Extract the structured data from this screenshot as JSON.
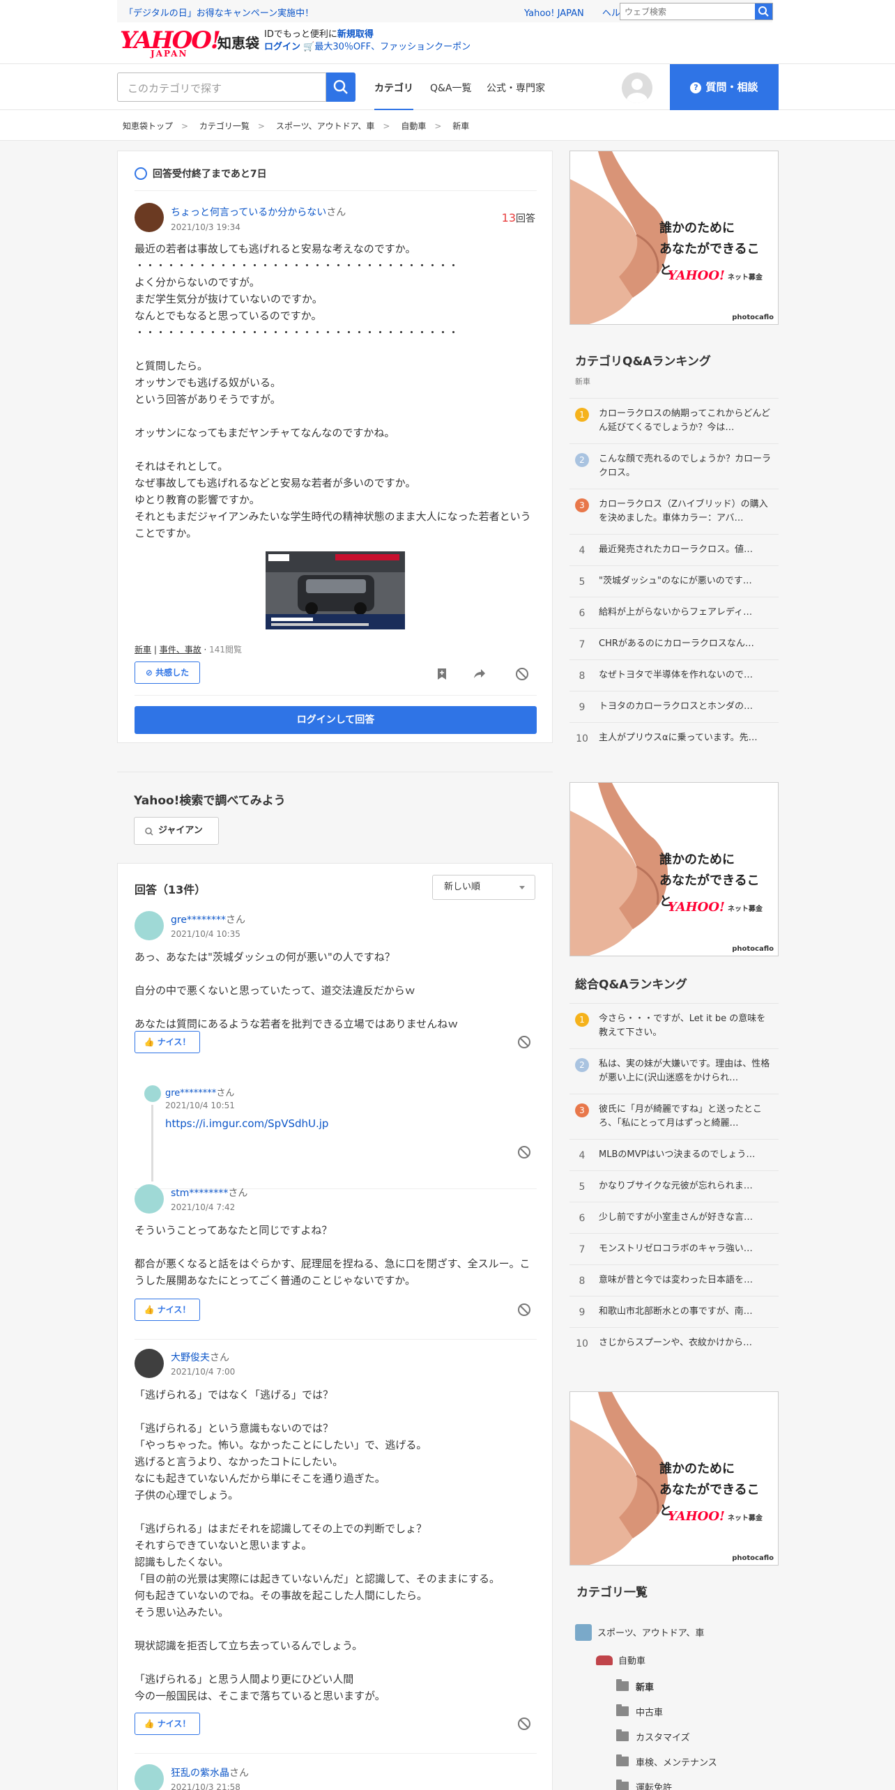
{
  "top": {
    "campaign": "「デジタルの日」お得なキャンペーン実施中！",
    "links": [
      "Yahoo! JAPAN",
      "ヘルプ"
    ],
    "web_search_placeholder": "ウェブ検索"
  },
  "header": {
    "logo_main": "YAHOO!",
    "logo_sub": "JAPAN",
    "service": "知恵袋",
    "id_line1_prefix": "IDでもっと便利に",
    "id_register": "新規取得",
    "id_login": "ログイン",
    "coupon": "最大30％OFF、ファッションクーポン"
  },
  "nav": {
    "category_search_placeholder": "このカテゴリで探す",
    "tabs": [
      "カテゴリ",
      "Q&A一覧",
      "公式・専門家"
    ],
    "ask_button": "質問・相談"
  },
  "breadcrumb": [
    "知恵袋トップ",
    "カテゴリ一覧",
    "スポーツ、アウトドア、車",
    "自動車",
    "新車"
  ],
  "question": {
    "deadline": "回答受付終了まであと7日",
    "user": "ちょっと何言っているか分からない",
    "san": "さん",
    "date": "2021/10/3 19:34",
    "answer_count": "13",
    "answer_count_label": "回答",
    "body": "最近の若者は事故しても逃げれると安易な考えなのですか。\n・・・・・・・・・・・・・・・・・・・・・・・・・・・・・・・\nよく分からないのですが。\nまだ学生気分が抜けていないのですか。\nなんとでもなると思っているのですか。\n・・・・・・・・・・・・・・・・・・・・・・・・・・・・・・・\n\nと質問したら。\nオッサンでも逃げる奴がいる。\nという回答がありそうですが。\n\nオッサンになってもまだヤンチャてなんなのですかね。\n\nそれはそれとして。\nなぜ事故しても逃げれるなどと安易な若者が多いのですか。\nゆとり教育の影響ですか。\nそれともまだジャイアンみたいな学生時代の精神状態のまま大人になった若者ということですか。",
    "tag1": "新車",
    "tag2": "事件、事故",
    "views": "141閲覧",
    "sympathy_button": "共感した",
    "login_answer_button": "ログインして回答"
  },
  "search_suggest": {
    "title": "Yahoo!検索で調べてみよう",
    "chip": "ジャイアン"
  },
  "answers_section": {
    "heading": "回答（13件）",
    "sort": "新しい順",
    "nice_label": "ナイス！",
    "san": "さん",
    "answers": [
      {
        "user": "gre********",
        "date": "2021/10/4 10:35",
        "body": "あっ、あなたは\"茨城ダッシュの何が悪い\"の人ですね？\n\n自分の中で悪くないと思っていたって、道交法違反だからｗ\n\nあなたは質問にあるような若者を批判できる立場ではありませんねｗ"
      },
      {
        "user": "stm********",
        "date": "2021/10/4 7:42",
        "body": "そういうことってあなたと同じですよね？\n\n都合が悪くなると話をはぐらかす、屁理屈を捏ねる、急に口を閉ざす、全スルー。こうした展開あなたにとってごく普通のことじゃないですか。"
      },
      {
        "user": "大野俊夫",
        "date": "2021/10/4 7:00",
        "body": "「逃げられる」ではなく「逃げる」では？\n\n「逃げられる」という意識もないのでは？\n「やっちゃった。怖い。なかったことにしたい」で、逃げる。\n逃げると言うより、なかったコトにしたい。\nなにも起きていないんだから単にそこを通り過ぎた。\n子供の心理でしょう。\n\n「逃げられる」はまだそれを認識してその上での判断でしょ？\nそれすらできていないと思いますよ。\n認識もしたくない。\n「目の前の光景は実際には起きていないんだ」と認識して、そのままにする。\n何も起きていないのでね。その事故を起こした人間にしたら。\nそう思い込みたい。\n\n現状認識を拒否して立ち去っているんでしょう。\n\n「逃げられる」と思う人間より更にひどい人間\n今の一般国民は、そこまで落ちていると思いますが。"
      },
      {
        "user": "狂乱の紫水晶",
        "date": "2021/10/3 21:58"
      }
    ],
    "reply": {
      "user": "gre********",
      "date": "2021/10/4 10:51",
      "link": "https://i.imgur.com/SpVSdhU.jp"
    }
  },
  "ads": {
    "text_line1": "誰かのために",
    "text_line2": "あなたができること",
    "brand": "YAHOO!",
    "brand_sub": "ネット募金",
    "credit": "photocaflo"
  },
  "category_ranking": {
    "title": "カテゴリQ&Aランキング",
    "subtitle": "新車",
    "items": [
      "カローラクロスの納期ってこれからどんどん延びてくるでしょうか？今は…",
      "こんな顔で売れるのでしょうか？カローラクロス。",
      "カローラクロス（Zハイブリッド）の購入を決めました。車体カラー：アバ…",
      "最近発売されたカローラクロス。値…",
      "\"茨城ダッシュ\"のなにが悪いのです…",
      "給料が上がらないからフェアレディ…",
      "CHRがあるのにカローラクロスなん…",
      "なぜトヨタで半導体を作れないので…",
      "トヨタのカローラクロスとホンダの…",
      "主人がプリウスαに乗っています。先…"
    ]
  },
  "overall_ranking": {
    "title": "総合Q&Aランキング",
    "items": [
      "今さら・・・ですが、Let it be の意味を教えて下さい。",
      "私は、実の妹が大嫌いです。理由は、性格が悪い上に(沢山迷惑をかけられ…",
      "彼氏に「月が綺麗ですね」と送ったところ、「私にとって月はずっと綺麗…",
      "MLBのMVPはいつ決まるのでしょう…",
      "かなりブサイクな元彼が忘れられま…",
      "少し前ですが小室圭さんが好きな言…",
      "モンストリゼロコラボのキャラ強い…",
      "意味が昔と今では変わった日本語を…",
      "和歌山市北部断水との事ですが、南…",
      "さじからスプーンや、衣紋かけから…"
    ]
  },
  "category_list": {
    "title": "カテゴリ一覧",
    "root": "スポーツ、アウトドア、車",
    "child": "自動車",
    "items": [
      "新車",
      "中古車",
      "カスタマイズ",
      "車検、メンテナンス",
      "運転免許"
    ]
  },
  "colors": {
    "accent": "#2f74e6",
    "medal_gold": "#f5b21b",
    "medal_silver": "#a9c3e0",
    "medal_bronze": "#e8774a",
    "answer_count": "#e83c3c"
  }
}
